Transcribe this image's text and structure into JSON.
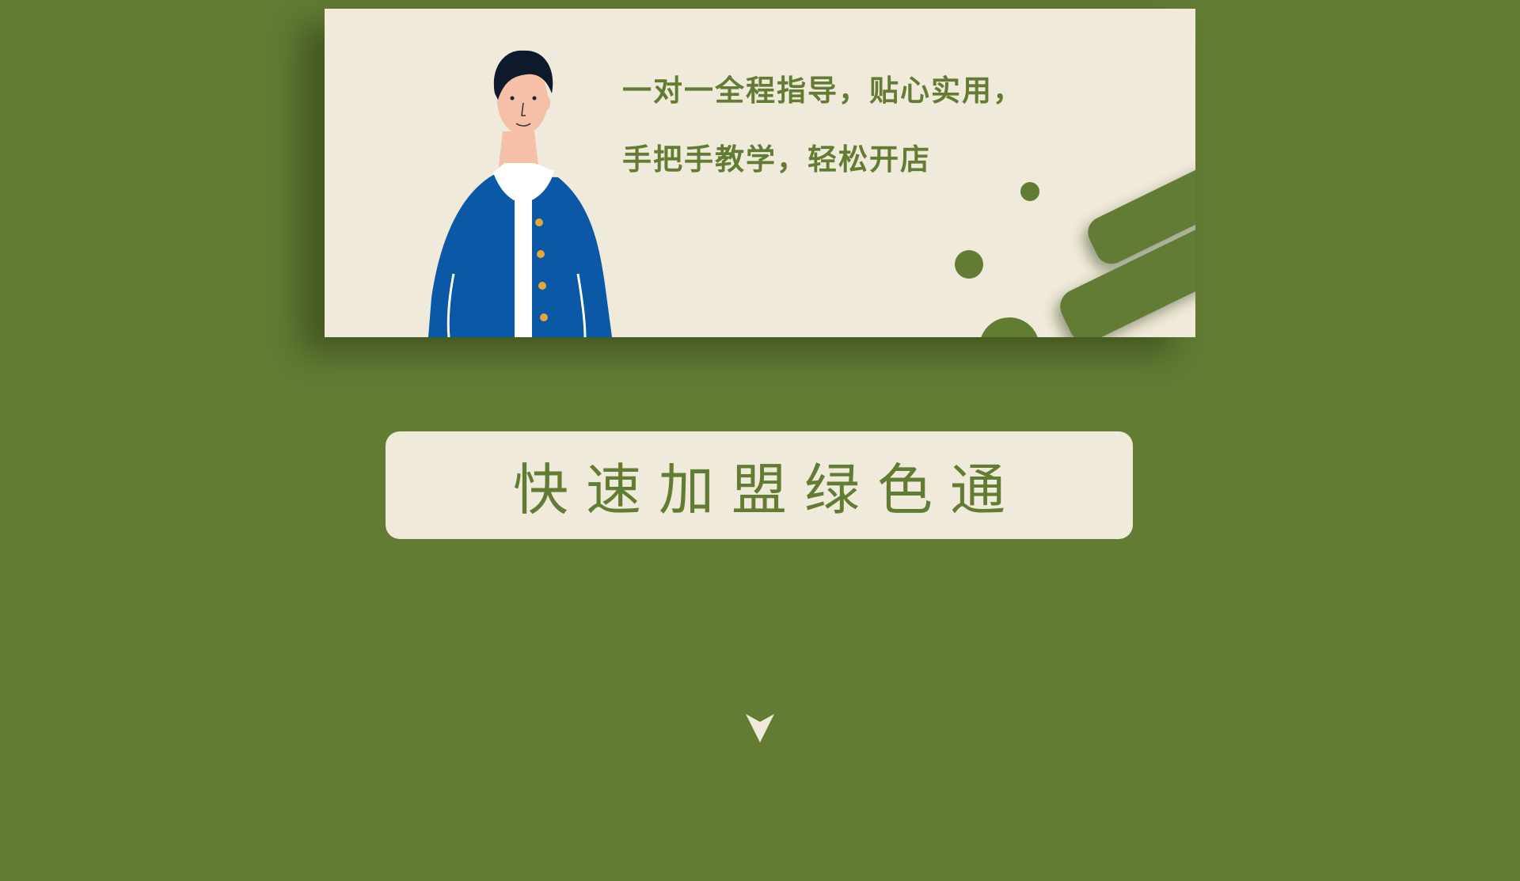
{
  "banner": {
    "line1": "一对一全程指导，贴心实用，",
    "line2": "手把手教学，轻松开店"
  },
  "cta": {
    "label": "快速加盟绿色通"
  },
  "icons": {
    "person": "person-illustration-icon",
    "arrow": "chevron-down-icon"
  },
  "colors": {
    "background": "#637c34",
    "card": "#f0eada",
    "accent": "#637c34",
    "jacket": "#0a58a6",
    "hair": "#0c1a2c",
    "skin": "#f5bfa8",
    "buttons": "#e2a93a"
  }
}
